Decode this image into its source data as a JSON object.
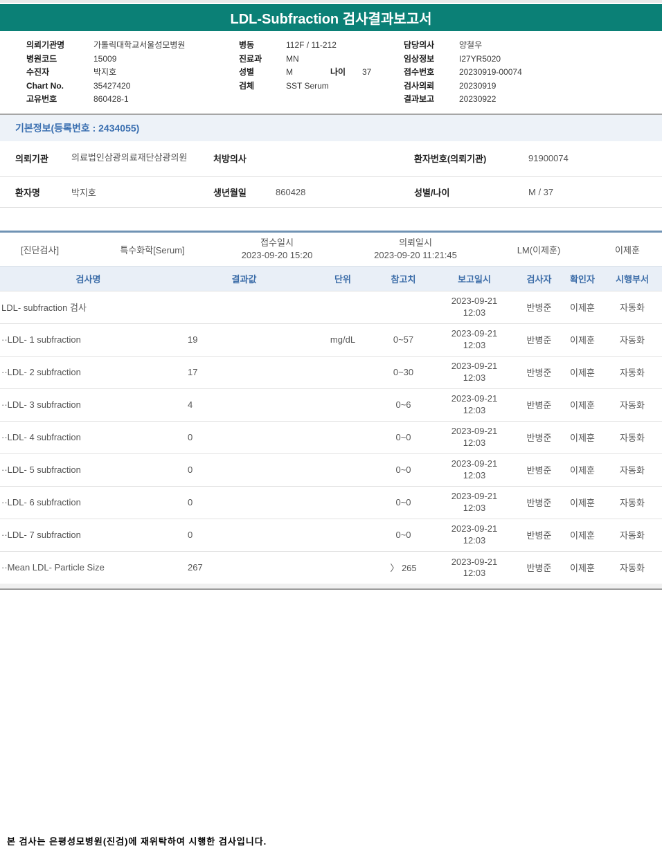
{
  "title": "LDL-Subfraction 검사결과보고서",
  "patient_header": {
    "left": [
      {
        "label": "의뢰기관명",
        "value": "가톨릭대학교서울성모병원"
      },
      {
        "label": "병원코드",
        "value": "15009"
      },
      {
        "label": "수진자",
        "value": "박지호"
      },
      {
        "label": "Chart No.",
        "value": "35427420"
      },
      {
        "label": "고유번호",
        "value": "860428-1"
      }
    ],
    "middle": [
      {
        "label": "병동",
        "value": "112F / 11-212"
      },
      {
        "label": "진료과",
        "value": "MN"
      },
      {
        "label": "성별",
        "value": "M",
        "label2": "나이",
        "value2": "37"
      },
      {
        "label": "검체",
        "value": "SST Serum"
      }
    ],
    "right": [
      {
        "label": "담당의사",
        "value": "양철우"
      },
      {
        "label": "임상정보",
        "value": "I27YR5020"
      },
      {
        "label": "접수번호",
        "value": "20230919-00074"
      },
      {
        "label": "검사의뢰",
        "value": "20230919"
      },
      {
        "label": "결과보고",
        "value": "20230922"
      }
    ]
  },
  "basic_info": {
    "section_title": "기본정보(등록번호 : 2434055)",
    "rows": [
      [
        {
          "label": "의뢰기관",
          "value": "의료법인삼광의료재단삼광의원"
        },
        {
          "label": "처방의사",
          "value": ""
        },
        {
          "label": "환자번호(의뢰기관)",
          "value": "91900074"
        }
      ],
      [
        {
          "label": "환자명",
          "value": "박지호"
        },
        {
          "label": "생년월일",
          "value": "860428"
        },
        {
          "label": "성별/나이",
          "value": "M / 37"
        }
      ]
    ]
  },
  "order_row": {
    "category": "[진단검사]",
    "test_group": "특수화학[Serum]",
    "receipt_label": "접수일시",
    "receipt_value": "2023-09-20 15:20",
    "request_label": "의뢰일시",
    "request_value": "2023-09-20 11:21:45",
    "doctor": "LM(이제훈)",
    "confirmer": "이제훈"
  },
  "results": {
    "columns": [
      "검사명",
      "결과값",
      "단위",
      "참고치",
      "보고일시",
      "검사자",
      "확인자",
      "시행부서"
    ],
    "rows": [
      {
        "name": "LDL- subfraction 검사",
        "value": "",
        "unit": "",
        "ref": "",
        "date": "2023-09-21",
        "time": "12:03",
        "tester": "반병준",
        "confirmer": "이제훈",
        "dept": "자동화"
      },
      {
        "name": "··LDL- 1 subfraction",
        "value": "19",
        "unit": "mg/dL",
        "ref": "0~57",
        "date": "2023-09-21",
        "time": "12:03",
        "tester": "반병준",
        "confirmer": "이제훈",
        "dept": "자동화"
      },
      {
        "name": "··LDL- 2 subfraction",
        "value": "17",
        "unit": "",
        "ref": "0~30",
        "date": "2023-09-21",
        "time": "12:03",
        "tester": "반병준",
        "confirmer": "이제훈",
        "dept": "자동화"
      },
      {
        "name": "··LDL- 3 subfraction",
        "value": "4",
        "unit": "",
        "ref": "0~6",
        "date": "2023-09-21",
        "time": "12:03",
        "tester": "반병준",
        "confirmer": "이제훈",
        "dept": "자동화"
      },
      {
        "name": "··LDL- 4 subfraction",
        "value": "0",
        "unit": "",
        "ref": "0~0",
        "date": "2023-09-21",
        "time": "12:03",
        "tester": "반병준",
        "confirmer": "이제훈",
        "dept": "자동화"
      },
      {
        "name": "··LDL- 5 subfraction",
        "value": "0",
        "unit": "",
        "ref": "0~0",
        "date": "2023-09-21",
        "time": "12:03",
        "tester": "반병준",
        "confirmer": "이제훈",
        "dept": "자동화"
      },
      {
        "name": "··LDL- 6 subfraction",
        "value": "0",
        "unit": "",
        "ref": "0~0",
        "date": "2023-09-21",
        "time": "12:03",
        "tester": "반병준",
        "confirmer": "이제훈",
        "dept": "자동화"
      },
      {
        "name": "··LDL- 7 subfraction",
        "value": "0",
        "unit": "",
        "ref": "0~0",
        "date": "2023-09-21",
        "time": "12:03",
        "tester": "반병준",
        "confirmer": "이제훈",
        "dept": "자동화"
      },
      {
        "name": "··Mean LDL- Particle Size",
        "value": "267",
        "unit": "",
        "ref": "〉 265",
        "date": "2023-09-21",
        "time": "12:03",
        "tester": "반병준",
        "confirmer": "이제훈",
        "dept": "자동화"
      }
    ]
  },
  "footer": {
    "note": "본 검사는 은평성모병원(진검)에 재위탁하여 시행한 검사입니다."
  },
  "colors": {
    "header_teal": "#0b8076",
    "section_blue_text": "#3a6fb0",
    "section_bar_bg": "#edf2f8",
    "table_header_bg": "#e9eff7",
    "table_header_text": "#3b6ca8",
    "steel_divider": "#7093b4"
  }
}
